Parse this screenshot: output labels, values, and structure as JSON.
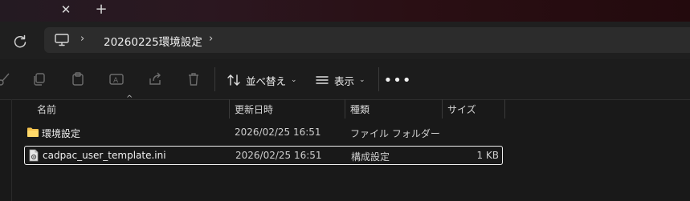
{
  "titlebar": {
    "close_tab_label": "✕",
    "new_tab_label": "+"
  },
  "address": {
    "sep1": "›",
    "folder": "20260225環境設定",
    "sep2": "›"
  },
  "toolbar": {
    "sort_label": "並べ替え",
    "view_label": "表示",
    "more_label": "•••",
    "chevron": "⌄"
  },
  "columns": {
    "name": "名前",
    "modified": "更新日時",
    "type": "種類",
    "size": "サイズ",
    "sort_caret": "^"
  },
  "files": [
    {
      "name": "環境設定",
      "modified": "2026/02/25 16:51",
      "type": "ファイル フォルダー",
      "size": "",
      "icon": "folder-icon",
      "selected": false
    },
    {
      "name": "cadpac_user_template.ini",
      "modified": "2026/02/25 16:51",
      "type": "構成設定",
      "size": "1 KB",
      "icon": "ini-file-icon",
      "selected": true
    }
  ],
  "colors": {
    "folder": "#f4c24f",
    "accent": "#ffffff",
    "background": "#191919"
  }
}
